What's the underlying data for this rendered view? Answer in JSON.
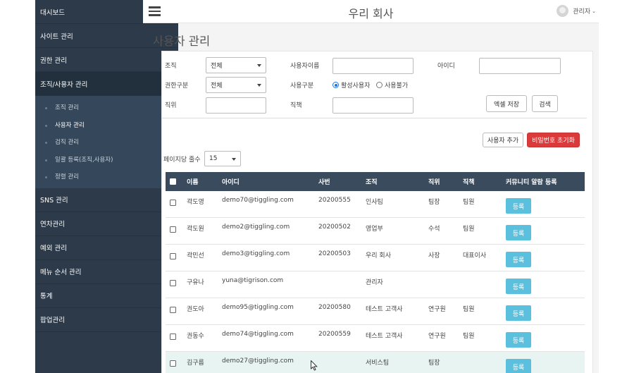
{
  "sidebar": {
    "items": [
      {
        "label": "대시보드",
        "has_children": false
      },
      {
        "label": "사이트 관리",
        "has_children": false
      },
      {
        "label": "권한 관리",
        "has_children": true
      },
      {
        "label": "조직/사용자 관리",
        "has_children": true,
        "expanded": true
      },
      {
        "label": "SNS 관리",
        "has_children": true
      },
      {
        "label": "연차관리",
        "has_children": true
      },
      {
        "label": "예외 관리",
        "has_children": true
      },
      {
        "label": "메뉴 순서 관리",
        "has_children": false
      },
      {
        "label": "통계",
        "has_children": true
      },
      {
        "label": "팝업관리",
        "has_children": false
      }
    ],
    "submenu": [
      "조직 관리",
      "사용자 관리",
      "검직 관리",
      "일괄 등록(조직,사용자)",
      "정렬 관리"
    ],
    "accent_color": "#2bb3a0"
  },
  "header": {
    "company": "우리 회사",
    "user": "관리자",
    "menu_icon": "hamburger-icon"
  },
  "page": {
    "title": "사용자 관리"
  },
  "filters": {
    "org_label": "조직",
    "org_value": "전체",
    "username_label": "사용자이름",
    "username_value": "",
    "id_label": "아이디",
    "id_value": "",
    "role_label": "권한구분",
    "role_value": "전체",
    "usertype_label": "사용구분",
    "active_option": "활성사용자",
    "inactive_option": "사용불가",
    "position_label": "직위",
    "position_value": "",
    "duty_label": "직책",
    "duty_value": "",
    "excel_btn": "엑셀 저장",
    "search_btn": "검색"
  },
  "actions": {
    "add_user": "사용자 추가",
    "reset_password": "비밀번호 초기화",
    "reset_color": "#dc3a3a"
  },
  "paging": {
    "label": "페이지당 줄수",
    "value": "15"
  },
  "table": {
    "headers": [
      "이름",
      "아이디",
      "사번",
      "조직",
      "직위",
      "직책",
      "커뮤니티 알람 등록"
    ],
    "register_label": "등록",
    "rows": [
      {
        "name": "곽도영",
        "id": "demo70@tiggling.com",
        "emp": "20200555",
        "org": "인사팀",
        "pos": "팀장",
        "duty": "팀원"
      },
      {
        "name": "곽도원",
        "id": "demo2@tiggling.com",
        "emp": "20200502",
        "org": "영업부",
        "pos": "수석",
        "duty": "팀원"
      },
      {
        "name": "곽민선",
        "id": "demo3@tiggling.com",
        "emp": "20200503",
        "org": "우리 회사",
        "pos": "사장",
        "duty": "대표이사"
      },
      {
        "name": "구유나",
        "id": "yuna@tigrison.com",
        "emp": "",
        "org": "관리자",
        "pos": "",
        "duty": ""
      },
      {
        "name": "권도아",
        "id": "demo95@tiggling.com",
        "emp": "20200580",
        "org": "테스트 고객사",
        "pos": "연구원",
        "duty": "팀원"
      },
      {
        "name": "권동수",
        "id": "demo74@tiggling.com",
        "emp": "20200559",
        "org": "테스트 고객사",
        "pos": "연구원",
        "duty": "팀원"
      },
      {
        "name": "김구름",
        "id": "demo27@tiggling.com",
        "emp": "",
        "org": "서비스팀",
        "pos": "팀장",
        "duty": ""
      }
    ],
    "header_color": "#3a4b5e",
    "button_color": "#5bc0de"
  }
}
